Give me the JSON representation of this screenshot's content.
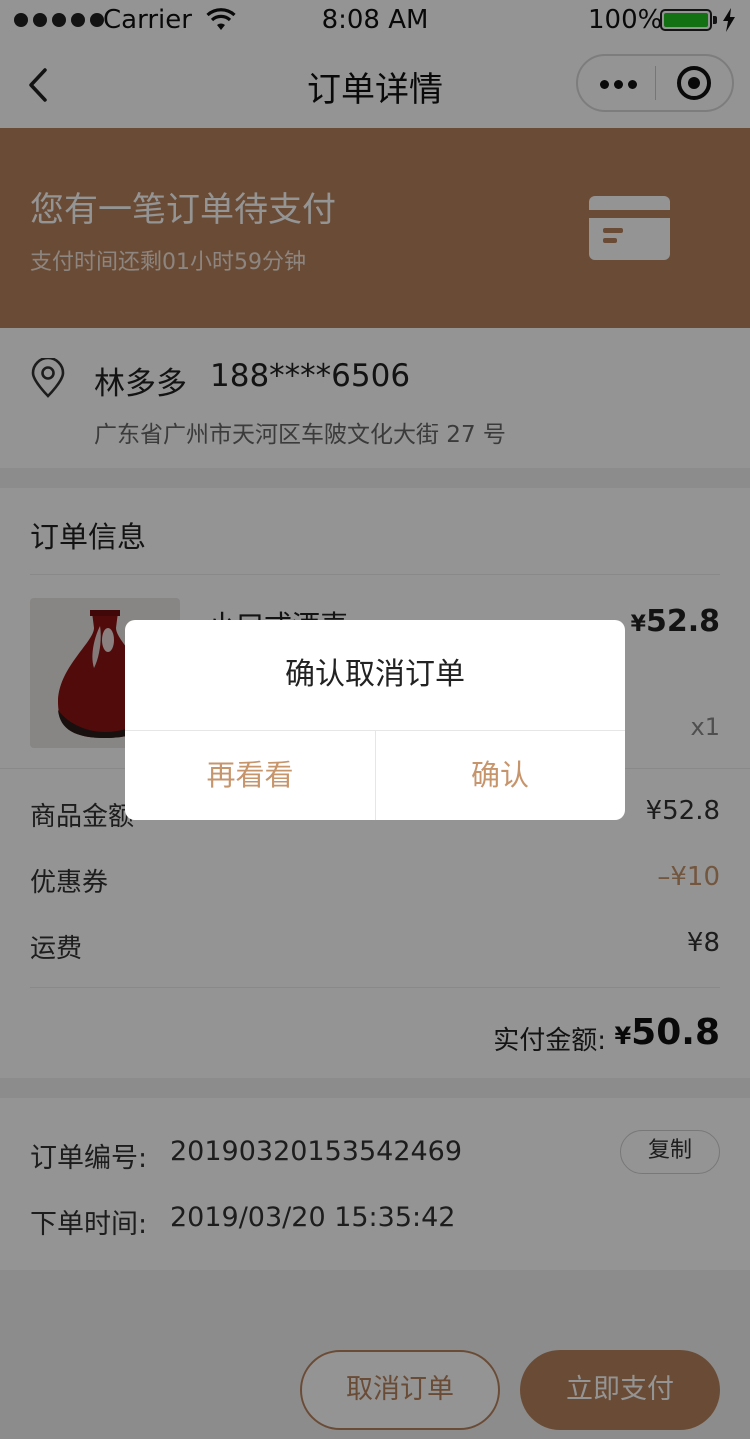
{
  "status_bar": {
    "carrier": "Carrier",
    "time": "8:08 AM",
    "battery": "100%",
    "battery_level": 1.0
  },
  "nav": {
    "title": "订单详情"
  },
  "banner": {
    "title": "您有一笔订单待支付",
    "subtitle": "支付时间还剩01小时59分钟",
    "color": "#b7835e"
  },
  "address": {
    "name": "林多多",
    "phone": "188****6506",
    "detail": "广东省广州市天河区车陂文化大街 27 号"
  },
  "order_info": {
    "title": "订单信息",
    "product": {
      "name": "小口式酒壶",
      "price_symbol": "¥",
      "price": "52.8",
      "qty": "x1"
    },
    "rows": [
      {
        "label": "商品金额",
        "value": "¥52.8"
      },
      {
        "label": "优惠券",
        "value": "–¥10"
      },
      {
        "label": "运费",
        "value": "¥8"
      }
    ],
    "total_label": "实付金额:",
    "total_symbol": "¥",
    "total_value": "50.8"
  },
  "meta": {
    "order_no_label": "订单编号:",
    "order_no": "20190320153542469",
    "copy_label": "复制",
    "time_label": "下单时间:",
    "time_value": "2019/03/20 15:35:42"
  },
  "actions": {
    "cancel_label": "取消订单",
    "pay_label": "立即支付"
  },
  "dialog": {
    "title": "确认取消订单",
    "left_label": "再看看",
    "right_label": "确认"
  }
}
